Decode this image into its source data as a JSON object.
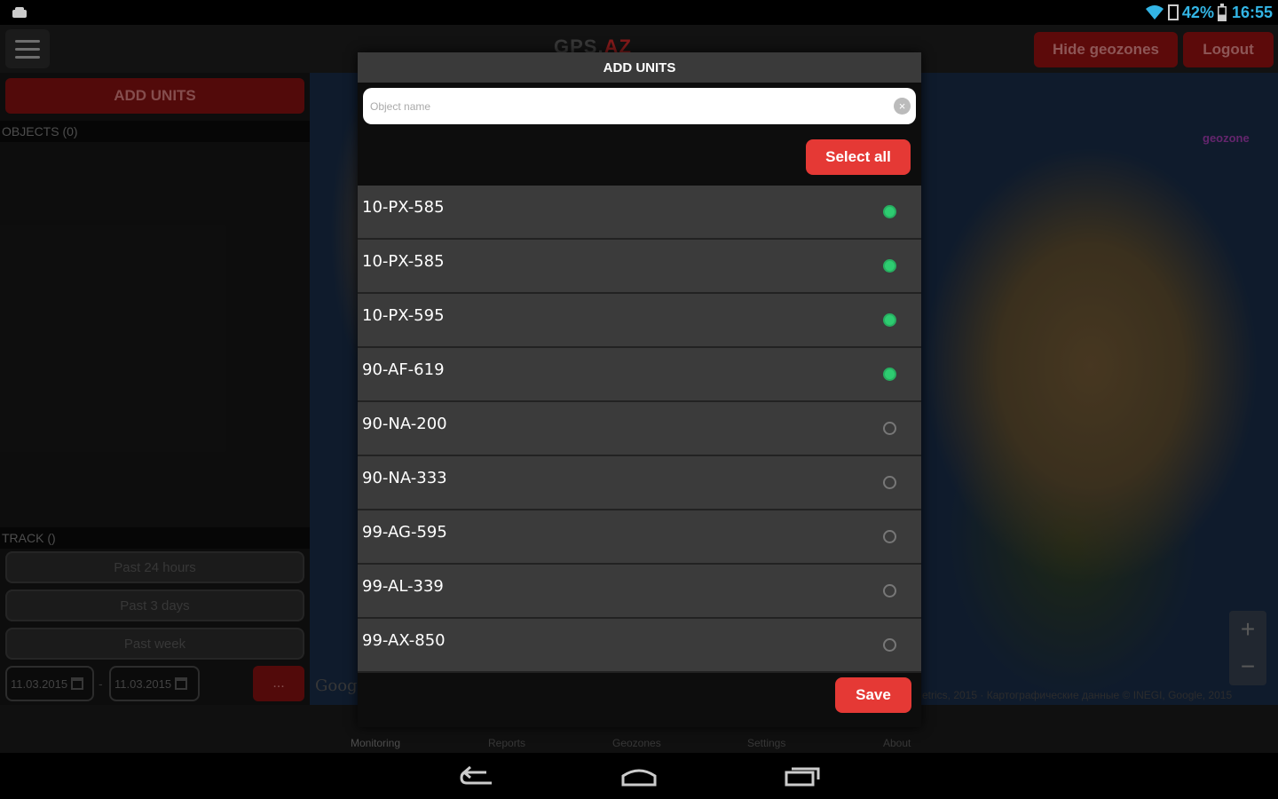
{
  "status_bar": {
    "battery_percent": "42%",
    "time": "16:55",
    "icons": [
      "android-notification-icon",
      "wifi-icon",
      "sim-icon",
      "battery-icon"
    ]
  },
  "app_bar": {
    "logo_prefix": "GPS.",
    "logo_suffix": "AZ",
    "hide_geozones_label": "Hide geozones",
    "logout_label": "Logout"
  },
  "left_panel": {
    "add_units_label": "ADD UNITS",
    "objects_header": "OBJECTS (0)",
    "track_header": "TRACK ()",
    "track_buttons": [
      "Past 24 hours",
      "Past 3 days",
      "Past week"
    ],
    "date_from": "11.03.2015",
    "date_to": "11.03.2015",
    "date_separator": "-",
    "go_label": "..."
  },
  "map": {
    "google_label": "Goog",
    "attribution": "etrics, 2015 · Картографические данные © INEGI, Google, 2015",
    "geozone_label": "geozone",
    "zoom_in": "+",
    "zoom_out": "−"
  },
  "tabs": [
    {
      "label": "Monitoring",
      "active": true
    },
    {
      "label": "Reports",
      "active": false
    },
    {
      "label": "Geozones",
      "active": false
    },
    {
      "label": "Settings",
      "active": false
    },
    {
      "label": "About",
      "active": false
    }
  ],
  "modal": {
    "title": "ADD UNITS",
    "search_placeholder": "Object name",
    "search_value": "",
    "select_all_label": "Select all",
    "save_label": "Save",
    "units": [
      {
        "name": "10-PX-585",
        "selected": true
      },
      {
        "name": "10-PX-585",
        "selected": true
      },
      {
        "name": "10-PX-595",
        "selected": true
      },
      {
        "name": "90-AF-619",
        "selected": true
      },
      {
        "name": "90-NA-200",
        "selected": false
      },
      {
        "name": "90-NA-333",
        "selected": false
      },
      {
        "name": "99-AG-595",
        "selected": false
      },
      {
        "name": "99-AL-339",
        "selected": false
      },
      {
        "name": "99-AX-850",
        "selected": false
      }
    ]
  },
  "colors": {
    "accent_red": "#e53935",
    "selected_green": "#2ecc71",
    "status_blue": "#33b5e5"
  }
}
